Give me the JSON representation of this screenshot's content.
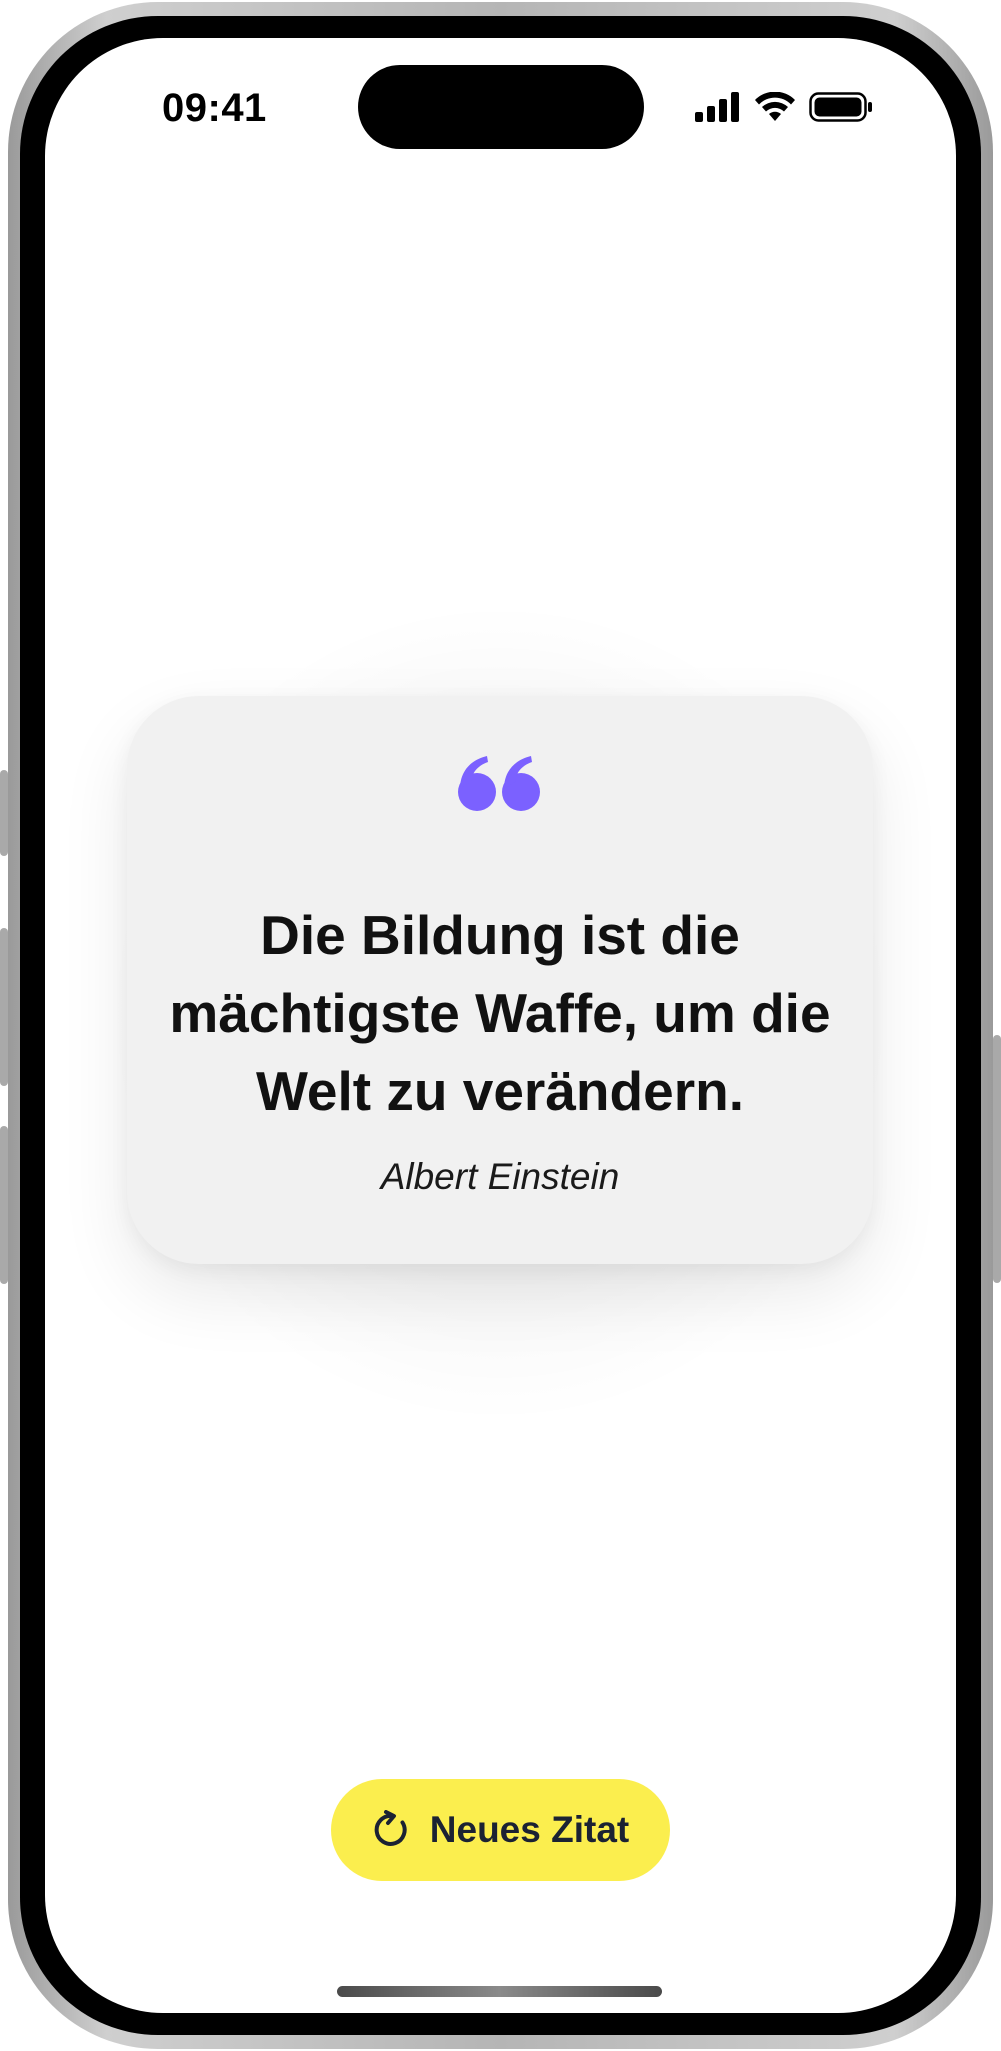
{
  "status_bar": {
    "time": "09:41",
    "icons": [
      "cellular-signal-icon",
      "wifi-icon",
      "battery-icon"
    ]
  },
  "quote_card": {
    "icon": "quote-marks-icon",
    "text": "Die Bildung ist die mächtigste Waffe, um die Welt zu verändern.",
    "author": "Albert Einstein"
  },
  "action_button": {
    "icon": "refresh-icon",
    "label": "Neues Zitat"
  },
  "colors": {
    "accent_purple": "#7b61ff",
    "button_yellow": "#fbee4e",
    "card_background": "#f1f1f1",
    "button_text": "#1b2233"
  }
}
